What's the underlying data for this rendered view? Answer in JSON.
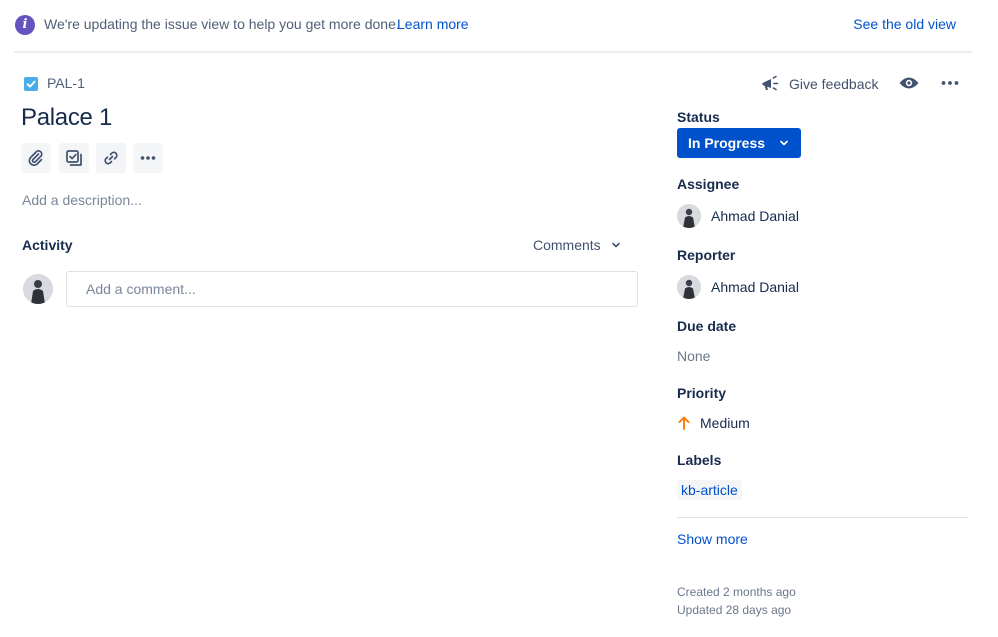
{
  "banner": {
    "icon": "info-icon",
    "message": "We're updating the issue view to help you get more done.",
    "learn_more": "Learn more",
    "old_view": "See the old view"
  },
  "issue": {
    "type_icon": "task-checkbox-icon",
    "key": "PAL-1",
    "title": "Palace 1",
    "toolbar": [
      "attach-icon",
      "subtask-icon",
      "link-icon",
      "more-icon"
    ],
    "description_placeholder": "Add a description..."
  },
  "activity": {
    "label": "Activity",
    "filter": "Comments",
    "comment_placeholder": "Add a comment..."
  },
  "header_actions": {
    "feedback": "Give feedback"
  },
  "fields": {
    "status_label": "Status",
    "status_value": "In Progress",
    "assignee_label": "Assignee",
    "assignee_name": "Ahmad Danial",
    "reporter_label": "Reporter",
    "reporter_name": "Ahmad Danial",
    "due_label": "Due date",
    "due_value": "None",
    "priority_label": "Priority",
    "priority_value": "Medium",
    "labels_label": "Labels",
    "labels": [
      "kb-article"
    ],
    "show_more": "Show more",
    "created": "Created 2 months ago",
    "updated": "Updated 28 days ago"
  },
  "colors": {
    "primary": "#0052CC",
    "info": "#6554C0",
    "priority_medium": "#FF7A00",
    "task": "#4BADE8"
  }
}
